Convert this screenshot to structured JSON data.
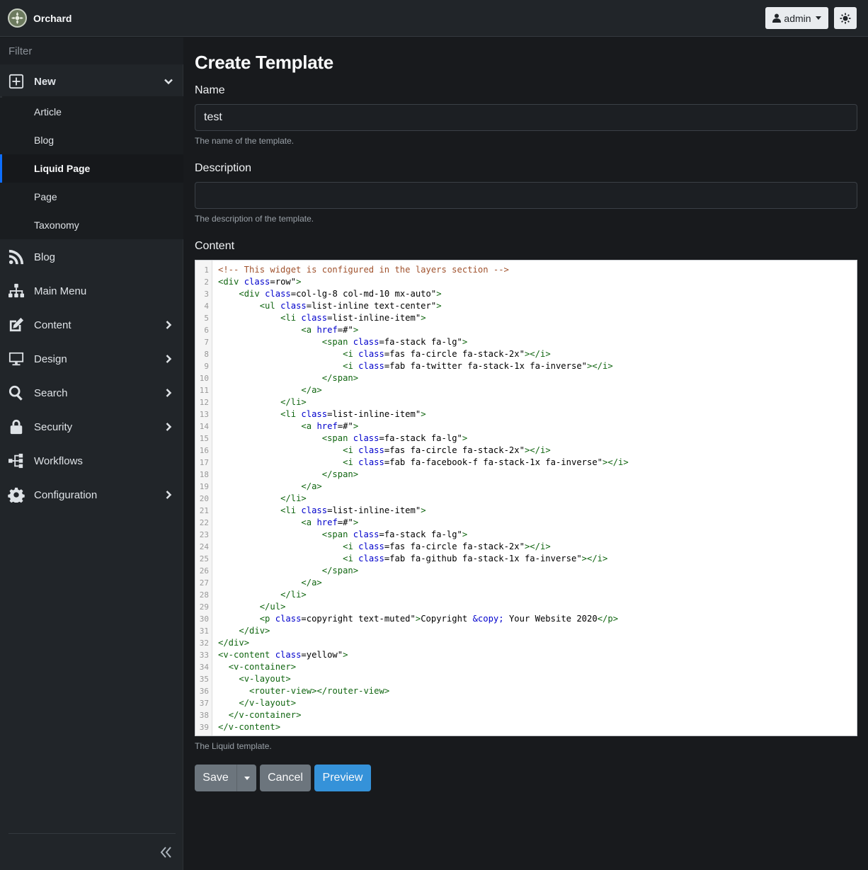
{
  "app": {
    "brand": "Orchard"
  },
  "header": {
    "user_label": "admin"
  },
  "sidebar": {
    "filter_placeholder": "Filter",
    "new": {
      "label": "New",
      "items": [
        "Article",
        "Blog",
        "Liquid Page",
        "Page",
        "Taxonomy"
      ],
      "active": "Liquid Page"
    },
    "items": [
      {
        "label": "Blog",
        "icon": "rss-icon"
      },
      {
        "label": "Main Menu",
        "icon": "sitemap-icon"
      },
      {
        "label": "Content",
        "icon": "edit-icon"
      },
      {
        "label": "Design",
        "icon": "desktop-icon"
      },
      {
        "label": "Search",
        "icon": "search-icon"
      },
      {
        "label": "Security",
        "icon": "lock-icon"
      },
      {
        "label": "Workflows",
        "icon": "workflow-icon"
      },
      {
        "label": "Configuration",
        "icon": "gear-icon"
      }
    ]
  },
  "page": {
    "title": "Create Template",
    "name_label": "Name",
    "name_value": "test",
    "name_hint": "The name of the template.",
    "description_label": "Description",
    "description_value": "",
    "description_hint": "The description of the template.",
    "content_label": "Content",
    "content_hint": "The Liquid template."
  },
  "editor": {
    "lines": [
      "<!-- This widget is configured in the layers section -->",
      "<div class=\"row\">",
      "    <div class=\"col-lg-8 col-md-10 mx-auto\">",
      "        <ul class=\"list-inline text-center\">",
      "            <li class=\"list-inline-item\">",
      "                <a href=\"#\">",
      "                    <span class=\"fa-stack fa-lg\">",
      "                        <i class=\"fas fa-circle fa-stack-2x\"></i>",
      "                        <i class=\"fab fa-twitter fa-stack-1x fa-inverse\"></i>",
      "                    </span>",
      "                </a>",
      "            </li>",
      "            <li class=\"list-inline-item\">",
      "                <a href=\"#\">",
      "                    <span class=\"fa-stack fa-lg\">",
      "                        <i class=\"fas fa-circle fa-stack-2x\"></i>",
      "                        <i class=\"fab fa-facebook-f fa-stack-1x fa-inverse\"></i>",
      "                    </span>",
      "                </a>",
      "            </li>",
      "            <li class=\"list-inline-item\">",
      "                <a href=\"#\">",
      "                    <span class=\"fa-stack fa-lg\">",
      "                        <i class=\"fas fa-circle fa-stack-2x\"></i>",
      "                        <i class=\"fab fa-github fa-stack-1x fa-inverse\"></i>",
      "                    </span>",
      "                </a>",
      "            </li>",
      "        </ul>",
      "        <p class=\"copyright text-muted\">Copyright &copy; Your Website 2020</p>",
      "    </div>",
      "</div>",
      "<v-content class=\"yellow\">",
      "  <v-container>",
      "    <v-layout>",
      "      <router-view></router-view>",
      "    </v-layout>",
      "  </v-container>",
      "</v-content>"
    ]
  },
  "actions": {
    "save": "Save",
    "cancel": "Cancel",
    "preview": "Preview"
  },
  "colors": {
    "accent": "#0d6efd",
    "preview_button": "#3592d9",
    "secondary_button": "#6c757d"
  }
}
